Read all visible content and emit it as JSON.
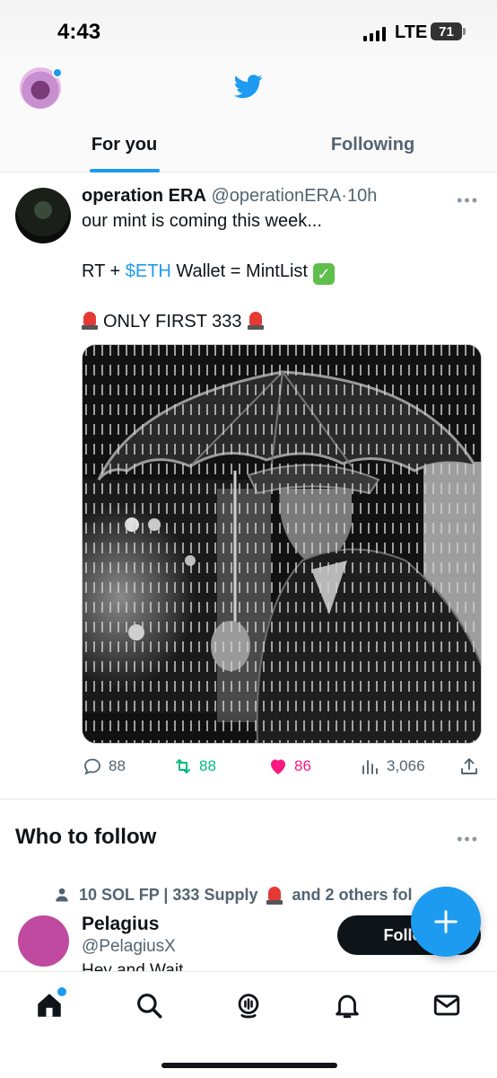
{
  "status_bar": {
    "time": "4:43",
    "network": "LTE",
    "battery": "71"
  },
  "header": {
    "tabs": [
      {
        "label": "For you",
        "active": true
      },
      {
        "label": "Following",
        "active": false
      }
    ]
  },
  "tweet": {
    "name": "operation ERA",
    "handle": "@operationERA",
    "separator": "·",
    "time": "10h",
    "line1": "our mint is coming this week...",
    "line2_prefix": "RT + ",
    "line2_cashtag": "$ETH",
    "line2_suffix": " Wallet = MintList",
    "line3": "ONLY FIRST 333",
    "media_icon": "man-with-umbrella-in-rain-image",
    "stats": {
      "replies": "88",
      "retweets": "88",
      "likes": "86",
      "views": "3,066"
    }
  },
  "who_to_follow": {
    "title": "Who to follow",
    "social_context_prefix": "10 SOL FP | 333 Supply",
    "social_context_suffix": "and 2 others fol",
    "suggestion": {
      "name": "Pelagius",
      "handle": "@PelagiusX",
      "bio_partial": "Hey and Wait",
      "follow_label": "Follow"
    }
  },
  "colors": {
    "accent": "#1d9bf0",
    "retweet": "#00ba7c",
    "like": "#f91880"
  }
}
